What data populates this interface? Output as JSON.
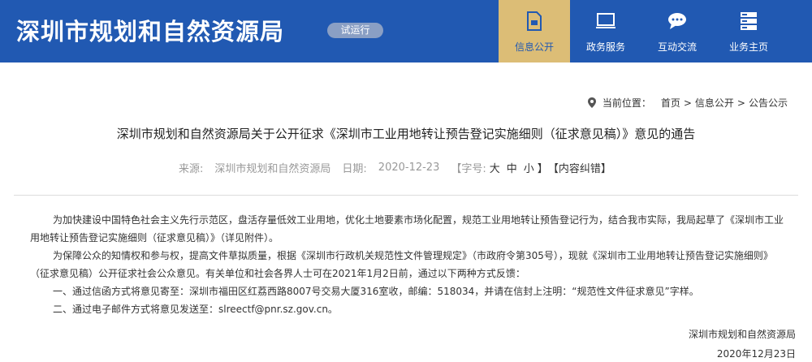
{
  "header": {
    "site_title": "深圳市规划和自然资源局",
    "trial_badge": "试运行",
    "nav": [
      {
        "label": "信息公开",
        "icon": "document-icon",
        "active": true
      },
      {
        "label": "政务服务",
        "icon": "monitor-icon",
        "active": false
      },
      {
        "label": "互动交流",
        "icon": "chat-bubble-icon",
        "active": false
      },
      {
        "label": "业务主页",
        "icon": "server-icon",
        "active": false
      }
    ]
  },
  "breadcrumb": {
    "label": "当前位置：",
    "items": [
      "首页",
      "信息公开",
      "公告公示"
    ],
    "separator": ">"
  },
  "article": {
    "title": "深圳市规划和自然资源局关于公开征求《深圳市工业用地转让预告登记实施细则（征求意见稿）》意见的通告",
    "meta": {
      "source_label": "来源:",
      "source_value": "深圳市规划和自然资源局",
      "date_label": "日期:",
      "date_value": "2020-12-23",
      "font_label": "【字号:",
      "font_large": "大",
      "font_medium": "中",
      "font_small": "小",
      "font_close": "】",
      "correction": "【内容纠错】"
    },
    "paragraphs": [
      "为加快建设中国特色社会主义先行示范区，盘活存量低效工业用地，优化土地要素市场化配置，规范工业用地转让预告登记行为，结合我市实际，我局起草了《深圳市工业用地转让预告登记实施细则（征求意见稿）》（详见附件）。",
      "为保障公众的知情权和参与权，提高文件草拟质量，根据《深圳市行政机关规范性文件管理规定》（市政府令第305号），现就《深圳市工业用地转让预告登记实施细则》（征求意见稿）公开征求社会公众意见。有关单位和社会各界人士可在2021年1月2日前，通过以下两种方式反馈：",
      "一、通过信函方式将意见寄至：深圳市福田区红荔西路8007号交易大厦316室收，邮编：518034，并请在信封上注明：“规范性文件征求意见”字样。",
      "二、通过电子邮件方式将意见发送至：slreectf@pnr.sz.gov.cn。"
    ],
    "signature_org": "深圳市规划和自然资源局",
    "signature_date": "2020年12月23日"
  },
  "colors": {
    "header_bg": "#2159b2",
    "nav_active_bg": "#dcbd76",
    "badge_bg": "#8a9fc4"
  }
}
